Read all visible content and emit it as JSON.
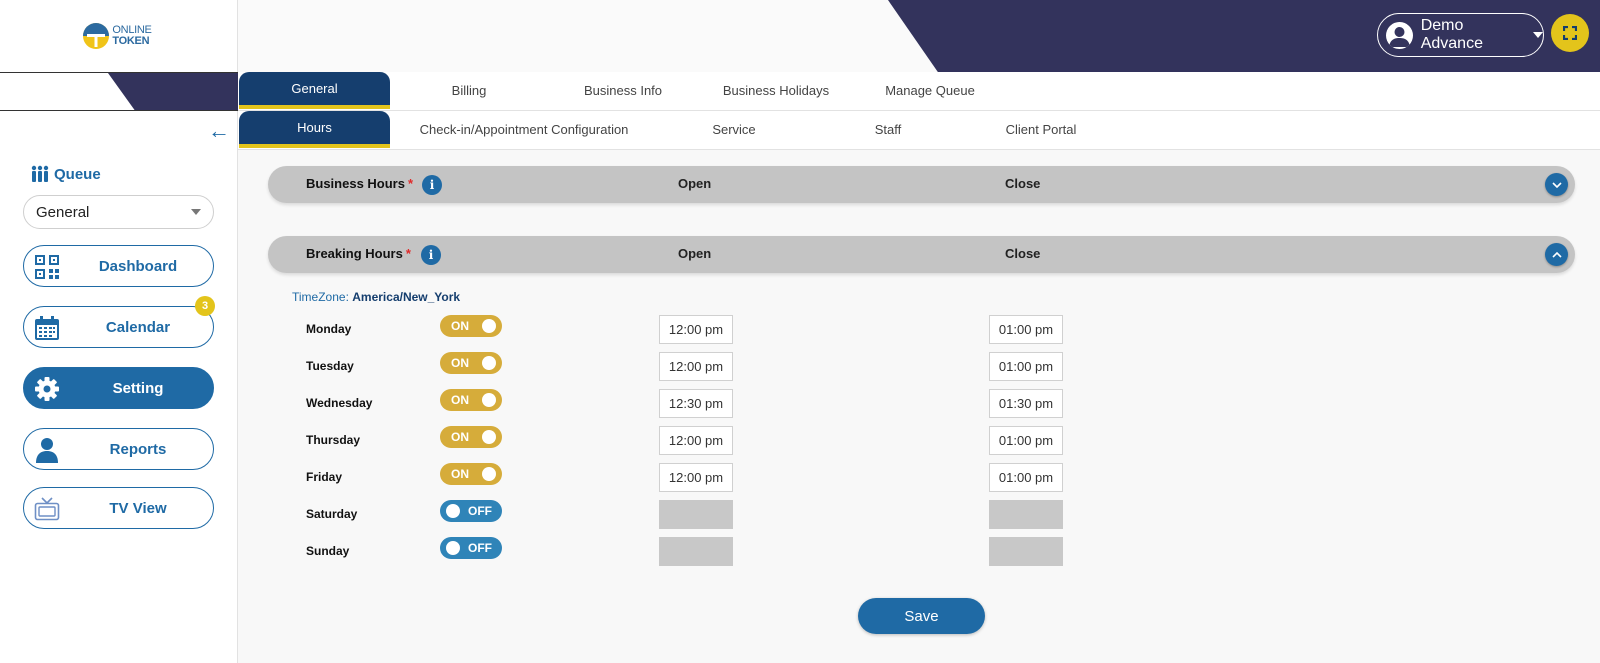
{
  "brand": {
    "line1": "ONLINE",
    "line2": "TOKEN"
  },
  "sidebar": {
    "queue_label": "Queue",
    "queue_select": "General",
    "nav": [
      {
        "label": "Dashboard",
        "icon": "qr-code-icon"
      },
      {
        "label": "Calendar",
        "icon": "calendar-icon",
        "badge": "3"
      },
      {
        "label": "Setting",
        "icon": "gear-icon",
        "active": true
      },
      {
        "label": "Reports",
        "icon": "person-icon"
      },
      {
        "label": "TV View",
        "icon": "tv-icon"
      }
    ]
  },
  "header": {
    "user_name": "Demo Advance"
  },
  "tabs_main": [
    "General",
    "Billing",
    "Business Info",
    "Business Holidays",
    "Manage Queue"
  ],
  "tabs_sub": [
    "Hours",
    "Check-in/Appointment Configuration",
    "Service",
    "Staff",
    "Client Portal"
  ],
  "business_hours": {
    "title": "Business Hours",
    "required": "*",
    "open_label": "Open",
    "close_label": "Close"
  },
  "breaking_hours": {
    "title": "Breaking Hours",
    "required": "*",
    "open_label": "Open",
    "close_label": "Close",
    "timezone_label": "TimeZone:",
    "timezone_value": "America/New_York",
    "days": [
      {
        "day": "Monday",
        "state": "ON",
        "open": "12:00 pm",
        "close": "01:00 pm"
      },
      {
        "day": "Tuesday",
        "state": "ON",
        "open": "12:00 pm",
        "close": "01:00 pm"
      },
      {
        "day": "Wednesday",
        "state": "ON",
        "open": "12:30 pm",
        "close": "01:30 pm"
      },
      {
        "day": "Thursday",
        "state": "ON",
        "open": "12:00 pm",
        "close": "01:00 pm"
      },
      {
        "day": "Friday",
        "state": "ON",
        "open": "12:00 pm",
        "close": "01:00 pm"
      },
      {
        "day": "Saturday",
        "state": "OFF",
        "open": "",
        "close": ""
      },
      {
        "day": "Sunday",
        "state": "OFF",
        "open": "",
        "close": ""
      }
    ]
  },
  "save_label": "Save",
  "colors": {
    "navy": "#33335c",
    "primary": "#1f6aa5",
    "tab_active": "#153e6e",
    "accent_yellow": "#e3c41b",
    "toggle_on": "#d6ac3a",
    "toggle_off": "#2f84b8"
  }
}
